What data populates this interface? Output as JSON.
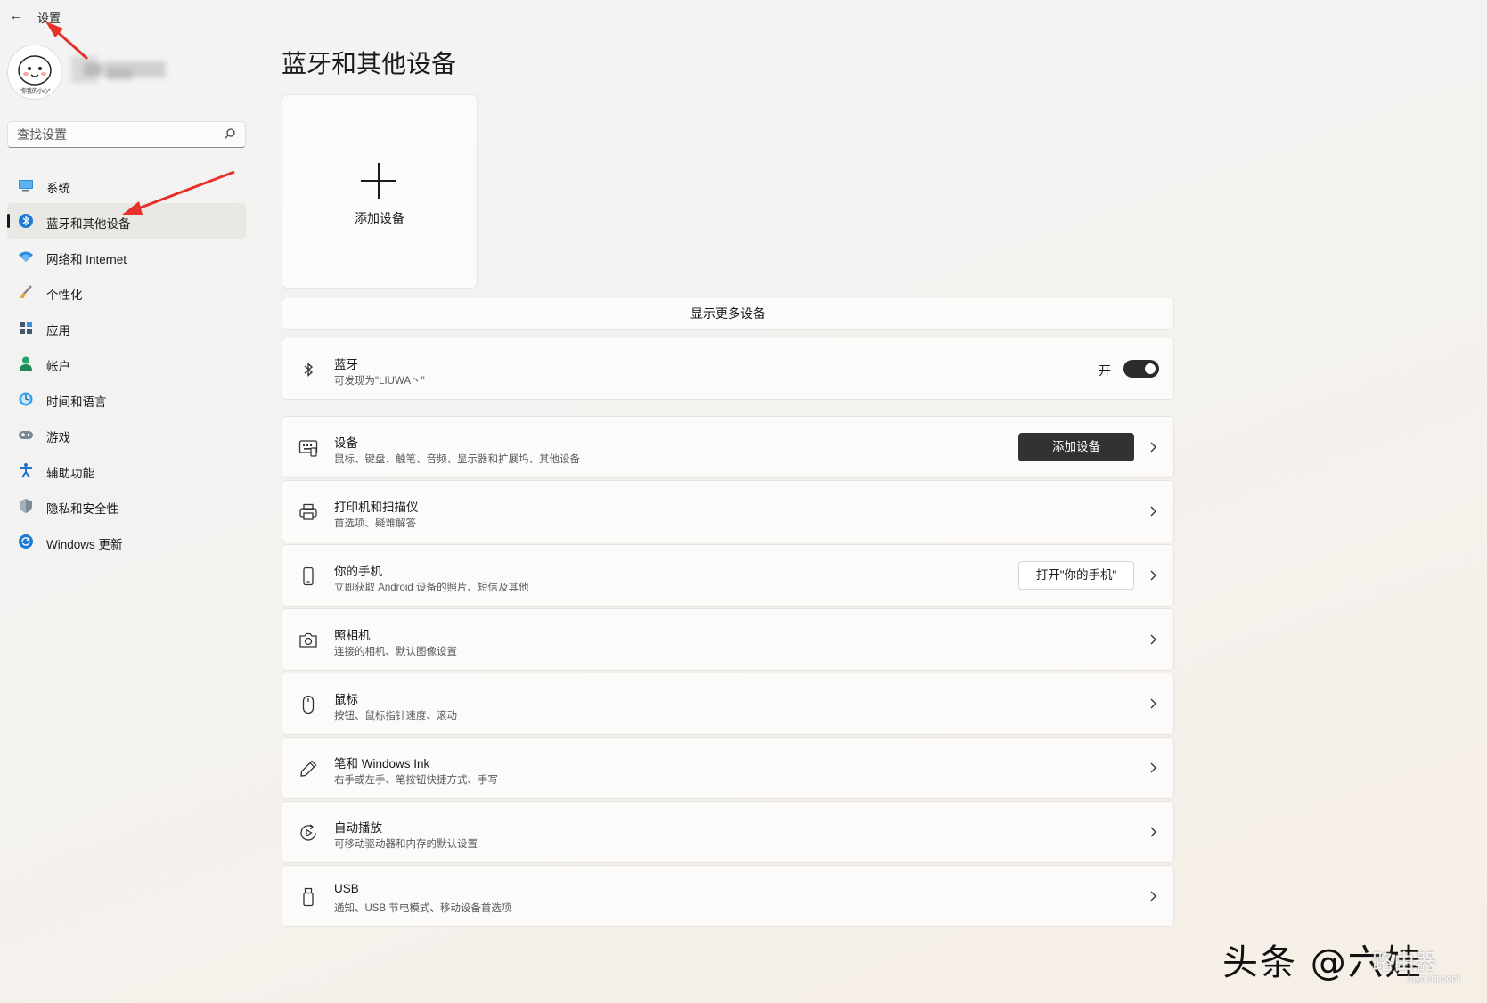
{
  "window": {
    "back_icon": "back-arrow-icon",
    "title": "设置"
  },
  "profile": {
    "avatar_caption": "*你我的小心*"
  },
  "search": {
    "placeholder": "查找设置",
    "icon": "search-icon"
  },
  "nav": {
    "items": [
      {
        "label": "系统",
        "icon": "system-icon",
        "active": false
      },
      {
        "label": "蓝牙和其他设备",
        "icon": "bluetooth-icon",
        "active": true
      },
      {
        "label": "网络和 Internet",
        "icon": "wifi-icon",
        "active": false
      },
      {
        "label": "个性化",
        "icon": "brush-icon",
        "active": false
      },
      {
        "label": "应用",
        "icon": "apps-icon",
        "active": false
      },
      {
        "label": "帐户",
        "icon": "account-icon",
        "active": false
      },
      {
        "label": "时间和语言",
        "icon": "time-language-icon",
        "active": false
      },
      {
        "label": "游戏",
        "icon": "gamepad-icon",
        "active": false
      },
      {
        "label": "辅助功能",
        "icon": "accessibility-icon",
        "active": false
      },
      {
        "label": "隐私和安全性",
        "icon": "shield-icon",
        "active": false
      },
      {
        "label": "Windows 更新",
        "icon": "update-icon",
        "active": false
      }
    ]
  },
  "main": {
    "page_title": "蓝牙和其他设备",
    "add_device_card_label": "添加设备",
    "show_more_label": "显示更多设备",
    "bluetooth": {
      "title": "蓝牙",
      "subtitle": "可发现为\"LIUWA丶\"",
      "toggle_text": "开",
      "toggle_on": true
    },
    "rows": [
      {
        "title": "设备",
        "subtitle": "鼠标、键盘、触笔、音频、显示器和扩展坞、其他设备",
        "icon": "devices-icon",
        "button": "添加设备",
        "button_style": "dark"
      },
      {
        "title": "打印机和扫描仪",
        "subtitle": "首选项、疑难解答",
        "icon": "printer-icon"
      },
      {
        "title": "你的手机",
        "subtitle": "立即获取 Android 设备的照片、短信及其他",
        "icon": "phone-icon",
        "button": "打开\"你的手机\"",
        "button_style": "light"
      },
      {
        "title": "照相机",
        "subtitle": "连接的相机、默认图像设置",
        "icon": "camera-icon"
      },
      {
        "title": "鼠标",
        "subtitle": "按钮、鼠标指针速度、滚动",
        "icon": "mouse-icon"
      },
      {
        "title": "笔和 Windows Ink",
        "subtitle": "右手或左手、笔按钮快捷方式、手写",
        "icon": "pen-icon"
      },
      {
        "title": "自动播放",
        "subtitle": "可移动驱动器和内存的默认设置",
        "icon": "autoplay-icon"
      },
      {
        "title": "USB",
        "subtitle": "通知、USB 节电模式、移动设备首选项",
        "icon": "usb-icon"
      }
    ]
  },
  "watermark": {
    "text": "头条 @六娃",
    "site": "路由器",
    "url": "luyouqi.com"
  },
  "colors": {
    "accent": "#0067c0",
    "annotation_arrow": "#e8302a",
    "primary_button": "#333232"
  }
}
